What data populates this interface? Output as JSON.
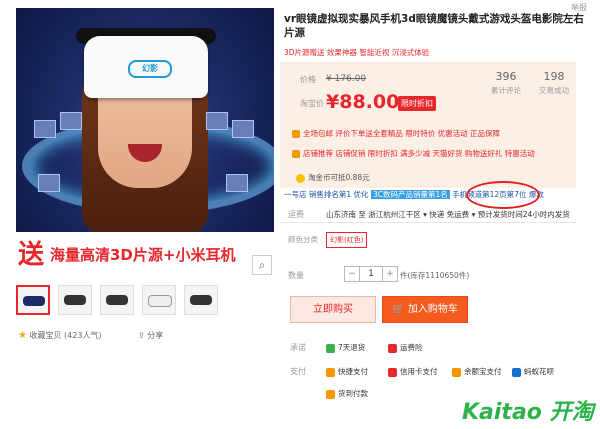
{
  "header": {
    "report": "举报"
  },
  "product": {
    "title": "vr眼镜虚拟现实暴风手机3d眼镜魔镜头戴式游戏头盔电影院左右片源",
    "subtitle": "3D片源赠送 效果神器 智能近视 沉浸式体验",
    "banner_big": "送",
    "banner_text": "海量高清3D片源+小米耳机",
    "headset_logo": "幻影"
  },
  "price": {
    "original_label": "价格",
    "original_value": "¥ 176.00",
    "sale_label": "淘宝价",
    "sale_value": "¥88.00",
    "badge": "限时折扣",
    "reviews_count": "396",
    "reviews_label": "累计评论",
    "sales_count": "198",
    "sales_label": "交易成功",
    "promo1": "全场包邮 评价下单送全套精品 限时特价 优惠活动 正品保障",
    "promo2": "店铺推荐 店铺促销 限时折扣 满多少减 天猫好货 购物送好礼 特惠活动",
    "coupon": "淘金币可抵0.88元"
  },
  "rank": {
    "prefix": "一号店 销售排名第1 优化",
    "highlight": "3C数码产品销量第1名",
    "suffix": "手机频道第12页第7位 爆款"
  },
  "shipping": {
    "label": "运费",
    "text": "山东济南 至 浙江杭州江干区 ▾ 快递 免运费 ▾ 预计发货时间24小时内发货"
  },
  "options": {
    "category_label": "颜色分类",
    "category_value": "幻影(红色)",
    "qty_label": "数量",
    "qty_value": "1",
    "qty_minus": "−",
    "qty_plus": "+",
    "stock": "件(库存1110650件)"
  },
  "actions": {
    "buy": "立即购买",
    "cart": "加入购物车",
    "favorite": "收藏宝贝 (423人气)",
    "share": "分享"
  },
  "service": {
    "promise_label": "承诺",
    "promise1": "7天退货",
    "promise2": "运费险",
    "pay_label": "支付",
    "pay1": "快捷支付",
    "pay2": "信用卡支付",
    "pay3": "余额宝支付",
    "pay4": "蚂蚁花呗",
    "pay5": "货到付款"
  },
  "watermark": "Kaitao 开淘",
  "colors": {
    "accent": "#e8262c",
    "cart": "#f55a1e",
    "price_bg": "#fcefe6",
    "watermark": "#2db34a"
  }
}
